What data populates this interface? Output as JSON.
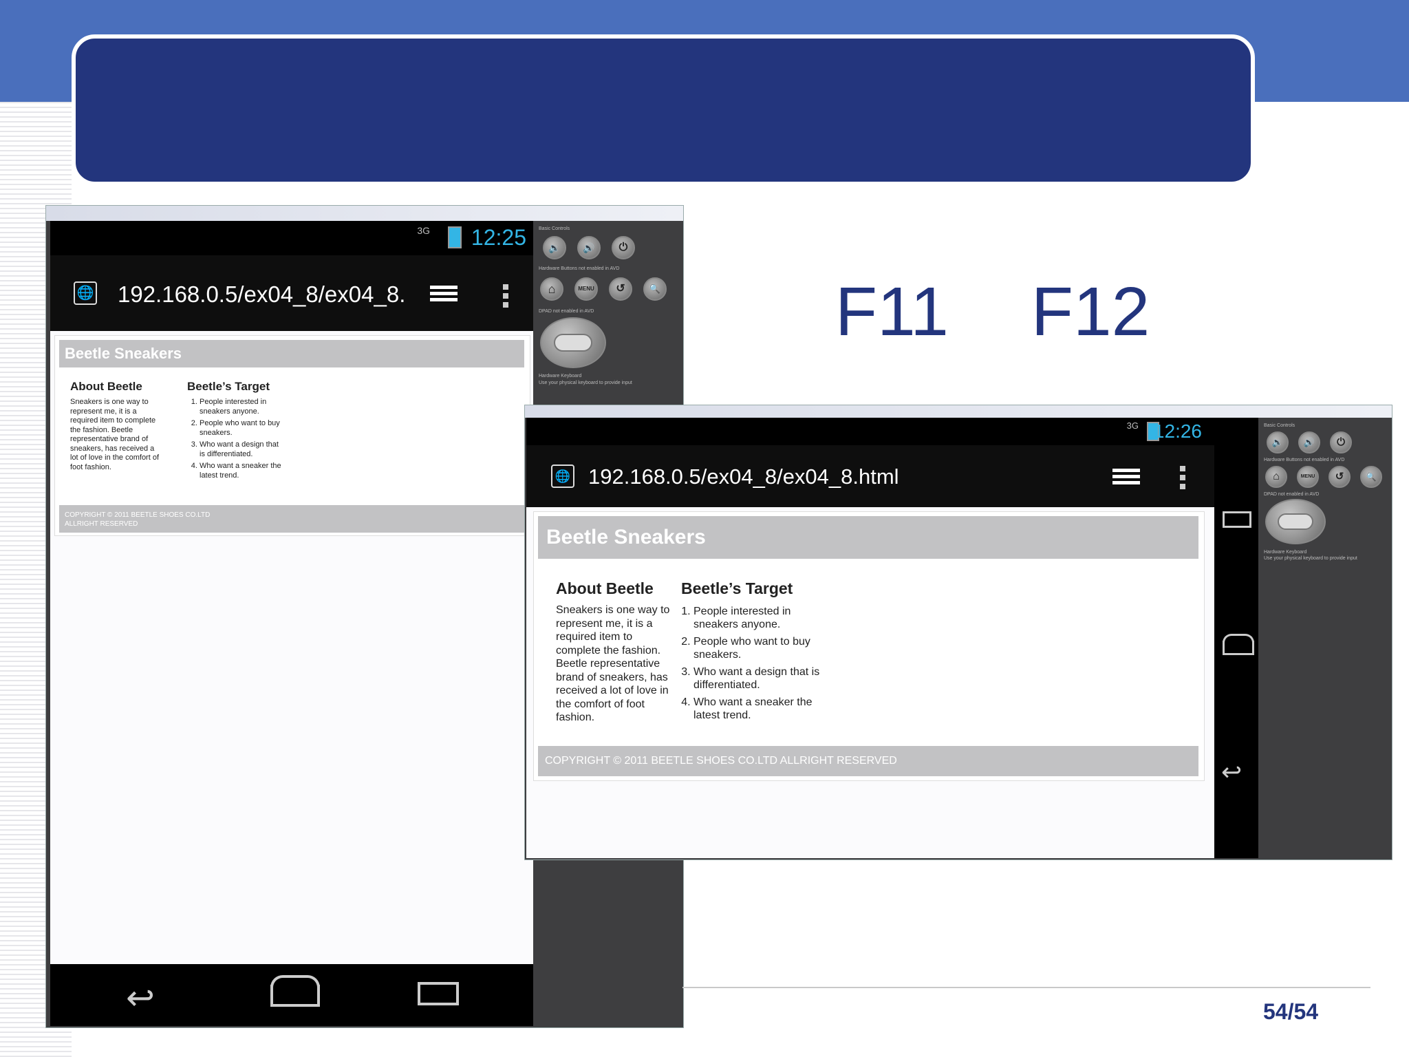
{
  "slide": {
    "fkeys": [
      "F11",
      "F12"
    ],
    "page_number": "54/54"
  },
  "emulator_small": {
    "network": "3G",
    "time": "12:25",
    "url": "192.168.0.5/ex04_8/ex04_8.",
    "site_header": "Beetle Sneakers",
    "about_title": "About Beetle",
    "about_text": "Sneakers is one way to represent me, it is a required item to complete the fashion. Beetle representative brand of sneakers, has received a lot of love in the comfort of foot fashion.",
    "target_title": "Beetle’s Target",
    "target_items": [
      "People interested in sneakers anyone.",
      "People who want to buy sneakers.",
      "Who want a design that is differentiated.",
      "Who want a sneaker the latest trend."
    ],
    "footer_line1": "COPYRIGHT © 2011 BEETLE SHOES CO.LTD",
    "footer_line2": "ALLRIGHT RESERVED",
    "controls": {
      "basic_label": "Basic Controls",
      "hardware_label": "Hardware Buttons not enabled in AVD",
      "dpad_label": "DPAD not enabled in AVD",
      "keyboard_label1": "Hardware Keyboard",
      "keyboard_label2": "Use your physical keyboard to provide input",
      "menu_label": "MENU"
    }
  },
  "emulator_large": {
    "network": "3G",
    "time": "12:26",
    "url": "192.168.0.5/ex04_8/ex04_8.html",
    "site_header": "Beetle Sneakers",
    "about_title": "About Beetle",
    "about_text": "Sneakers is one way to represent me, it is a required item to complete the fashion. Beetle representative brand of sneakers, has received a lot of love in the comfort of foot fashion.",
    "target_title": "Beetle’s Target",
    "target_items": [
      "People interested in sneakers anyone.",
      "People who want to buy sneakers.",
      "Who want a design that is differentiated.",
      "Who want a sneaker the latest trend."
    ],
    "footer": "COPYRIGHT © 2011 BEETLE SHOES CO.LTD ALLRIGHT RESERVED",
    "controls": {
      "basic_label": "Basic Controls",
      "hardware_label": "Hardware Buttons not enabled in AVD",
      "dpad_label": "DPAD not enabled in AVD",
      "keyboard_label1": "Hardware Keyboard",
      "keyboard_label2": "Use your physical keyboard to provide input",
      "menu_label": "MENU"
    }
  },
  "icons": {
    "globe": "🌐",
    "back": "↩",
    "vol_down": "🔉",
    "vol_up": "🔊",
    "power": "⏻",
    "home": "⌂",
    "rotate": "↺",
    "search": "🔍"
  },
  "colors": {
    "slide_blue": "#23357d",
    "top_band": "#4a6fbc",
    "android_clock": "#33b5e5"
  }
}
